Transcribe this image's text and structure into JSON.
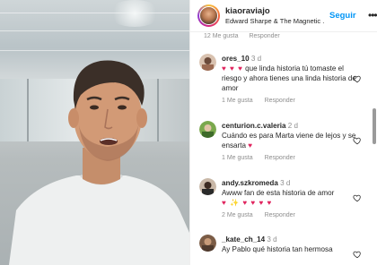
{
  "header": {
    "username": "kiaoraviajo",
    "song": "Edward Sharpe & The Magnetic ...",
    "follow_label": "Seguir",
    "more_label": "•••"
  },
  "top_meta": {
    "likes": "12 Me gusta",
    "reply": "Responder"
  },
  "comments": [
    {
      "user": "ores_10",
      "time": "3 d",
      "text_emoji": "♥ ♥ ♥",
      "text": " que linda historia tú tomaste el riesgo y ahora tienes una linda historia de amor",
      "likes": "1 Me gusta",
      "reply": "Responder"
    },
    {
      "user": "centurion.c.valeria",
      "time": "2 d",
      "text": "Cuándo es para Marta viene de lejos y se ensarta ",
      "text_emoji": "♥",
      "likes": "1 Me gusta",
      "reply": "Responder"
    },
    {
      "user": "andy.szkromeda",
      "time": "3 d",
      "text": "Awww fan de esta historia de amor",
      "text_emoji": "♥ ✨ ♥ ♥ ♥ ♥",
      "likes": "2 Me gusta",
      "reply": "Responder"
    },
    {
      "user": "_kate_ch_14",
      "time": "3 d",
      "text": "Ay Pablo qué historia tan hermosa"
    }
  ],
  "colors": {
    "accent": "#0095f6",
    "text": "#262626",
    "muted": "#8e8e8e",
    "heart": "#e0245e"
  },
  "icons": {
    "heart": "heart-icon",
    "more": "more-horizontal-icon"
  }
}
